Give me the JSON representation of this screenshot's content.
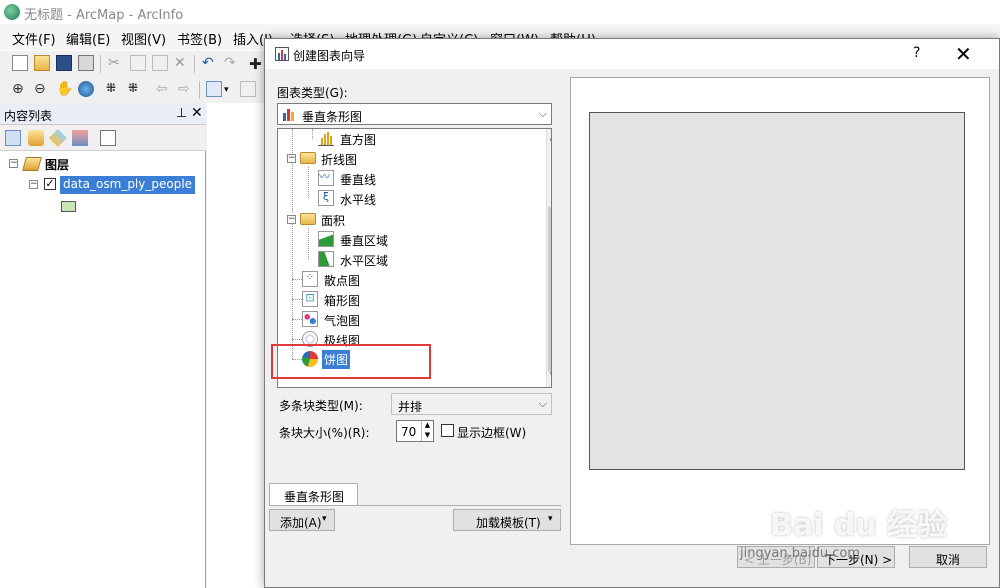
{
  "window": {
    "title": "无标题 - ArcMap - ArcInfo"
  },
  "menu": [
    {
      "label": "文件(F)"
    },
    {
      "label": "编辑(E)"
    },
    {
      "label": "视图(V)"
    },
    {
      "label": "书签(B)"
    },
    {
      "label": "插入(I)"
    },
    {
      "label": "选择(S)"
    },
    {
      "label": "地理处理(G)"
    },
    {
      "label": "自定义(C)"
    },
    {
      "label": "窗口(W)"
    },
    {
      "label": "帮助(H)"
    }
  ],
  "toc": {
    "title": "内容列表",
    "pin_glyph": "⊥",
    "close_glyph": "✕",
    "root_label": "图层",
    "layer_name": "data_osm_ply_people",
    "layer_checked": true,
    "swatch_color": "#c8e6b4"
  },
  "dialog": {
    "title": "创建图表向导",
    "help_glyph": "?",
    "close_glyph": "✕",
    "chart_type_label": "图表类型(G):",
    "chart_type_value": "垂直条形图",
    "tree": {
      "histogram": "直方图",
      "line_group": "折线图",
      "vertical_line": "垂直线",
      "horizontal_line": "水平线",
      "area_group": "面积",
      "vertical_area": "垂直区域",
      "horizontal_area": "水平区域",
      "scatter": "散点图",
      "box": "箱形图",
      "bubble": "气泡图",
      "polar": "极线图",
      "pie": "饼图"
    },
    "multi_bar_label": "多条块类型(M):",
    "multi_bar_value": "并排",
    "bar_size_label": "条块大小(%)(R):",
    "bar_size_value": "70",
    "show_border_label": "显示边框(W)",
    "tab_label": "垂直条形图",
    "add_button": "添加(A)",
    "load_template_button": "加载模板(T)",
    "prev_button": "< 上一步(B)",
    "next_button": "下一步(N) >",
    "cancel_button": "取消"
  },
  "watermark": {
    "text": "Bai du 经验",
    "url": "jingyan.baidu.com"
  }
}
